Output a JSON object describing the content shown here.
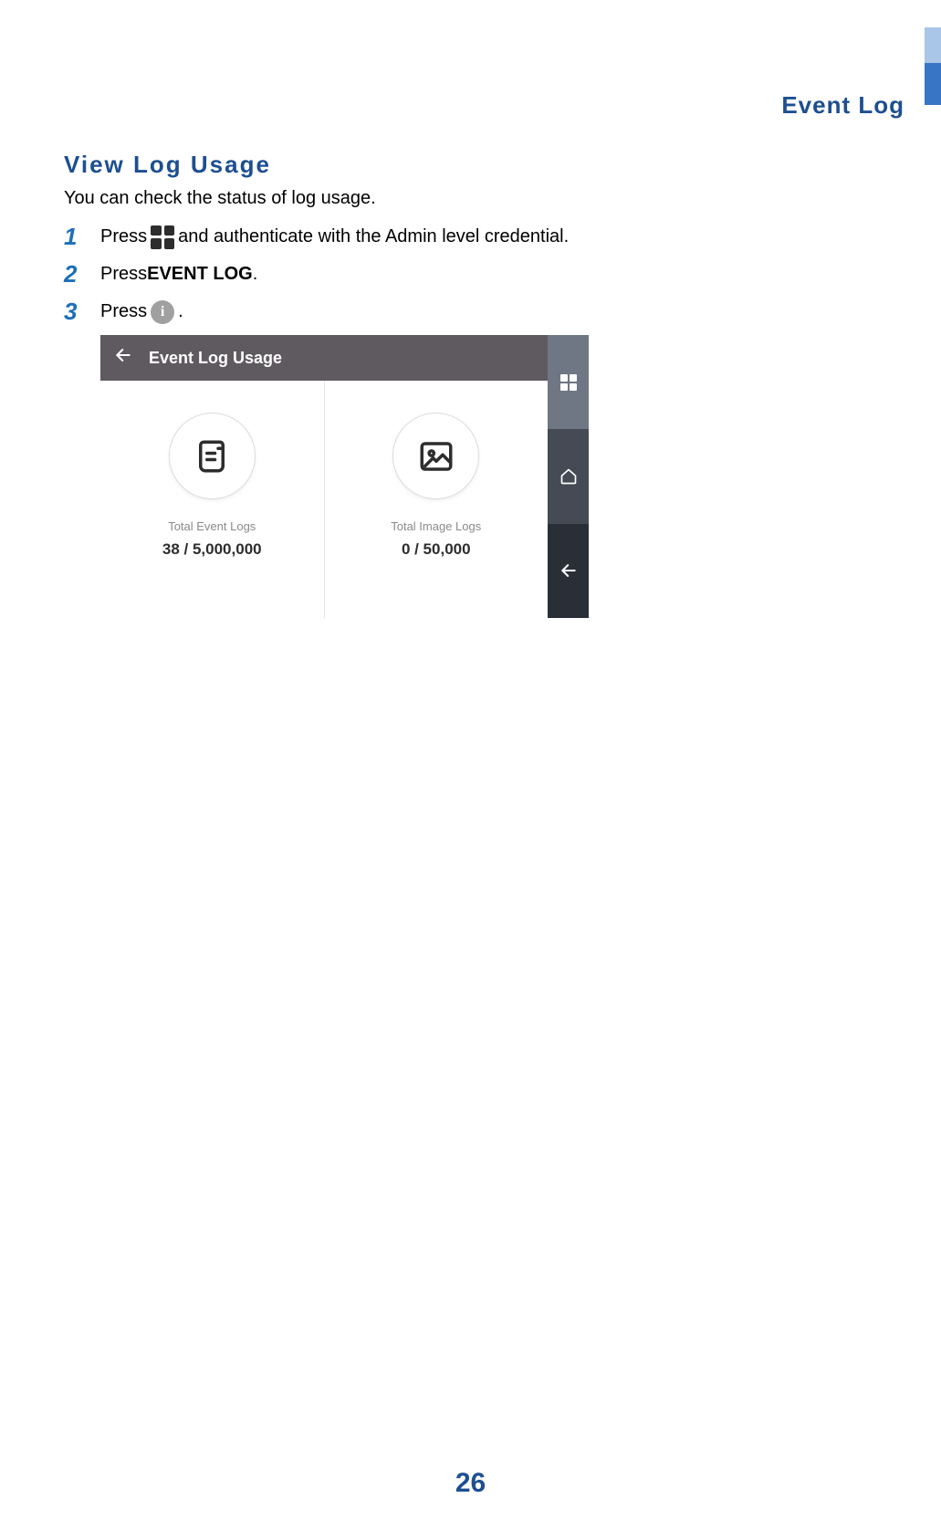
{
  "header": {
    "page_section": "Event Log"
  },
  "section": {
    "title": "View Log Usage",
    "intro": "You can check the status of log usage."
  },
  "steps": [
    {
      "num": "1",
      "before": "Press ",
      "after": " and authenticate with the Admin level credential."
    },
    {
      "num": "2",
      "before": "Press ",
      "bold": "EVENT LOG",
      "after_punct": "."
    },
    {
      "num": "3",
      "before": "Press ",
      "after_punct": "."
    }
  ],
  "device": {
    "title": "Event Log Usage",
    "metrics": {
      "event": {
        "label": "Total Event Logs",
        "value": "38 / 5,000,000"
      },
      "image": {
        "label": "Total Image Logs",
        "value": "0 / 50,000"
      }
    }
  },
  "page_number": "26"
}
